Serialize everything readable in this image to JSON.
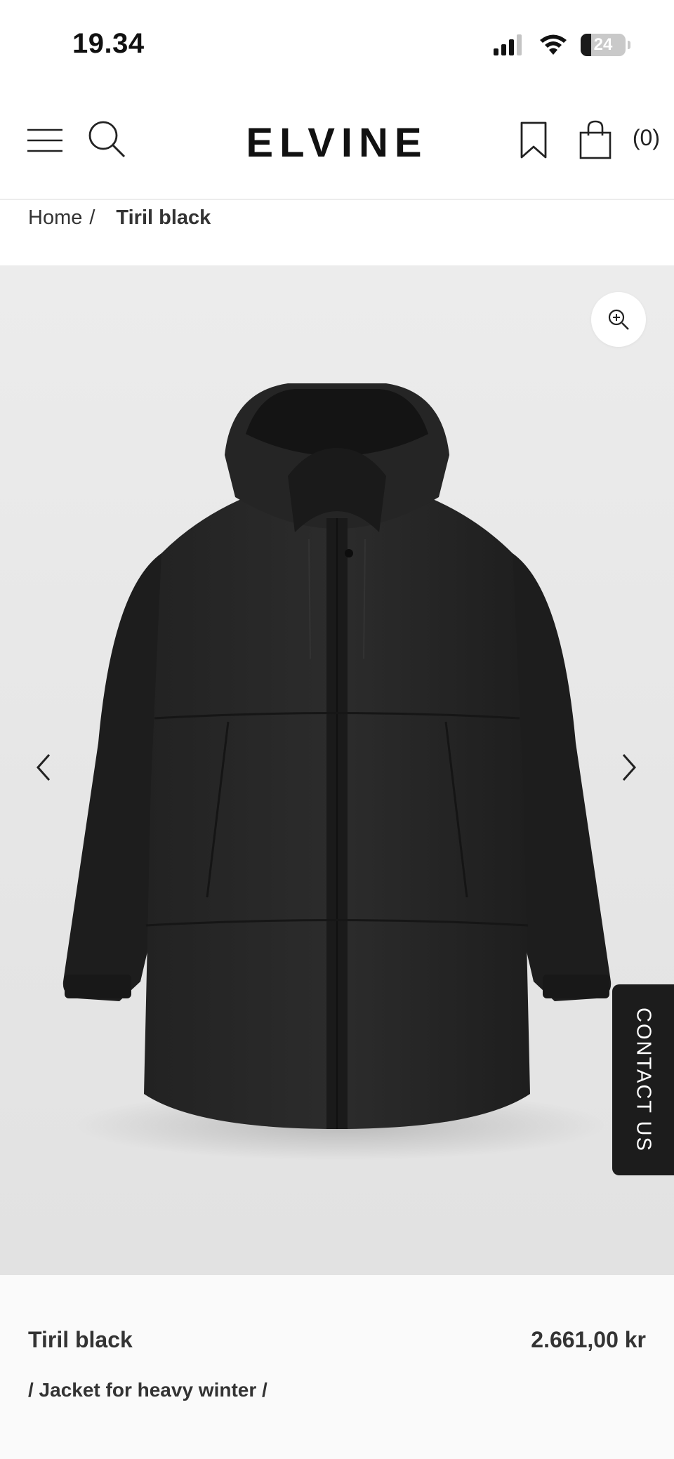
{
  "status_bar": {
    "time": "19.34",
    "battery_percent": 24,
    "battery_label": "24",
    "signal_icon": "cellular-signal-icon",
    "wifi_icon": "wifi-icon"
  },
  "header": {
    "logo": "ELVINE",
    "menu_icon": "hamburger-menu-icon",
    "search_icon": "search-icon",
    "wishlist_icon": "bookmark-icon",
    "cart_icon": "shopping-bag-icon",
    "cart_count": "(0)"
  },
  "breadcrumb": {
    "home": "Home",
    "separator": "/",
    "current": "Tiril black"
  },
  "gallery": {
    "zoom_icon": "zoom-in-icon",
    "prev_icon": "chevron-left-icon",
    "next_icon": "chevron-right-icon",
    "image_subject": "black hooded winter jacket"
  },
  "contact_tab": {
    "label": "CONTACT US"
  },
  "product": {
    "name": "Tiril black",
    "price": "2.661,00 kr",
    "subtitle": "/ Jacket for heavy winter /"
  },
  "colors": {
    "text": "#333333",
    "contact_bg": "#1c1c1c",
    "image_bg": "#e8e8e8"
  }
}
